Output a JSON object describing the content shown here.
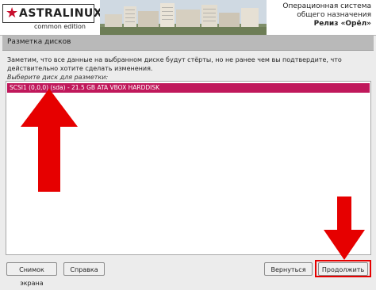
{
  "header": {
    "logo_name": "ASTRALINUX",
    "logo_edition": "common edition",
    "release_line1": "Операционная система",
    "release_line2": "общего назначения",
    "release_line3": "Релиз «Орёл»"
  },
  "page_title": "Разметка дисков",
  "notice": "Заметим, что все данные на выбранном диске будут стёрты, но не ранее чем вы подтвердите, что действительно хотите сделать изменения.",
  "prompt": "Выберите диск для разметки:",
  "disks": [
    {
      "label": "SCSI1 (0,0,0) (sda) - 21.5 GB ATA VBOX HARDDISK",
      "selected": true
    }
  ],
  "buttons": {
    "screenshot": "Снимок экрана",
    "help": "Справка",
    "back": "Вернуться",
    "continue": "Продолжить"
  },
  "colors": {
    "selection": "#c0185b",
    "arrow": "#e60000"
  }
}
